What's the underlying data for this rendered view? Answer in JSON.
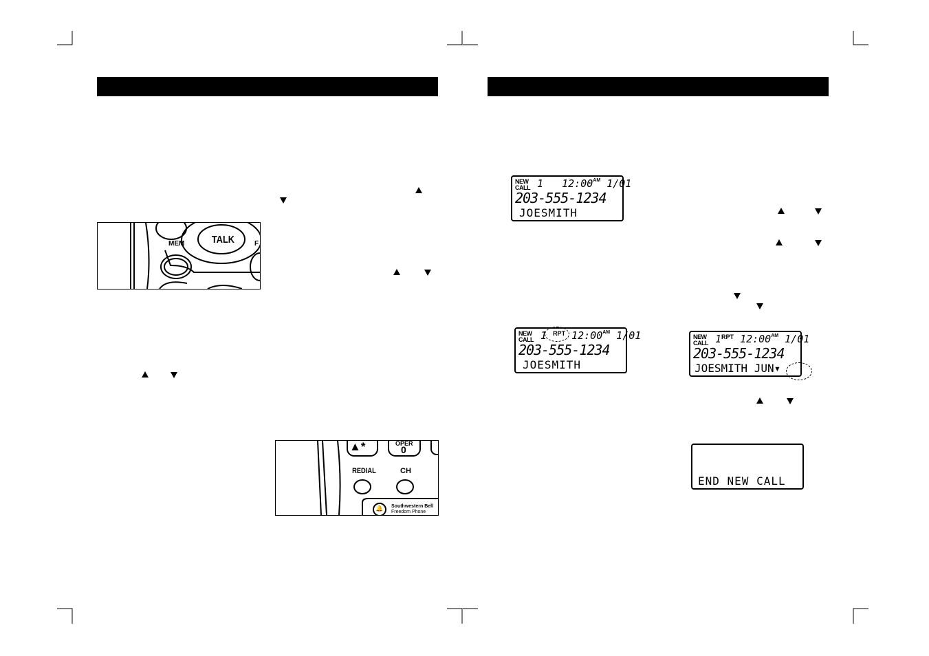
{
  "left_page": {
    "header_title": "",
    "talk_image": {
      "buttons": [
        "MEM",
        "TALK",
        "F"
      ]
    },
    "redial_image": {
      "buttons": [
        "▲*",
        "OPER",
        "0",
        "REDIAL",
        "CH"
      ],
      "brand_line1": "Southwestern Bell",
      "brand_line2": "Freedom Phone"
    }
  },
  "right_page": {
    "header_title": "",
    "displays": [
      {
        "label_top": "NEW",
        "label_bottom": "CALL",
        "index": "1",
        "rpt": "",
        "time": "12:00",
        "ampm": "AM",
        "date": "1/01",
        "number": "203-555-1234",
        "name": "JOESMITH"
      },
      {
        "label_top": "NEW",
        "label_bottom": "CALL",
        "index": "1",
        "rpt": "RPT",
        "time": "12:00",
        "ampm": "AM",
        "date": "1/01",
        "number": "203-555-1234",
        "name": "JOESMITH"
      },
      {
        "label_top": "NEW",
        "label_bottom": "CALL",
        "index": "1",
        "rpt": "RPT",
        "time": "12:00",
        "ampm": "AM",
        "date": "1/01",
        "number": "203-555-1234",
        "name": "JOESMITH JUN▾"
      },
      {
        "name": "END NEW CALL"
      }
    ]
  },
  "icons": {
    "up": "up-arrow-icon",
    "down": "down-arrow-icon"
  }
}
